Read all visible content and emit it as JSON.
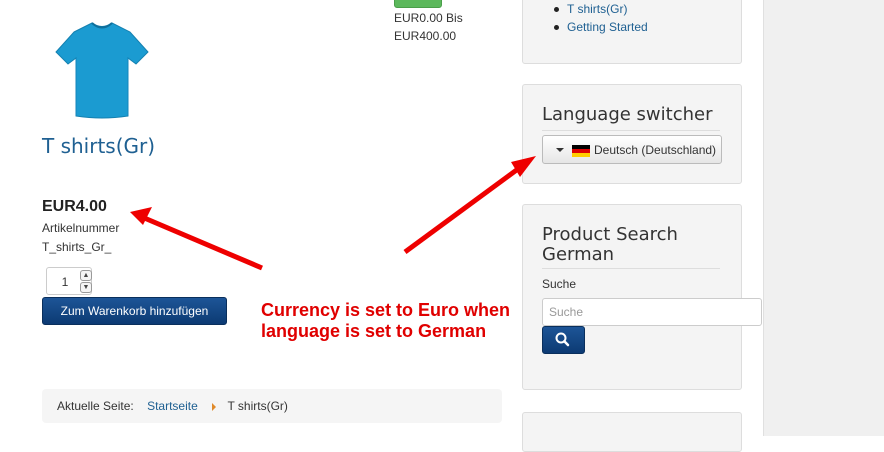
{
  "product": {
    "image_icon": "tshirt-image",
    "title": "T shirts(Gr)",
    "price": "EUR4.00",
    "sku_label": "Artikelnummer",
    "sku_value": "T_shirts_Gr_",
    "quantity": "1",
    "add_to_cart_label": "Zum Warenkorb hinzufügen"
  },
  "price_filter": {
    "from_text": "EUR0.00 Bis",
    "to_text": "EUR400.00"
  },
  "breadcrumb": {
    "prefix": "Aktuelle Seite:",
    "home": "Startseite",
    "current": "T shirts(Gr)"
  },
  "sidebar": {
    "menu_items": [
      {
        "label": "T shirts(Gr)"
      },
      {
        "label": "Getting Started"
      }
    ],
    "language_switcher": {
      "title": "Language switcher",
      "selected": "Deutsch (Deutschland)",
      "flag_icon": "german-flag-icon"
    },
    "product_search": {
      "title": "Product Search German",
      "label": "Suche",
      "placeholder": "Suche",
      "button_icon": "search-icon"
    }
  },
  "annotation": {
    "line1": "Currency is set to Euro when",
    "line2": "language is set to German"
  },
  "colors": {
    "link": "#1f6092",
    "primary_button": "#164a88",
    "annotation": "#e00000",
    "tshirt": "#1b9bd1"
  }
}
